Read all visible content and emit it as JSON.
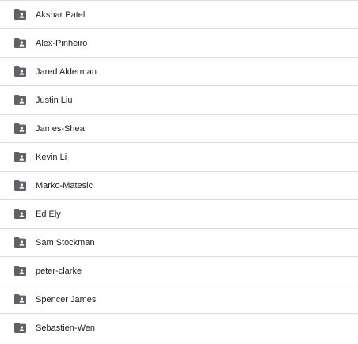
{
  "colors": {
    "folder_icon": "#5f6368",
    "divider": "#dadce0",
    "text": "#202124"
  },
  "folders": [
    {
      "label": "Akshar Patel",
      "icon": "shared-folder-icon"
    },
    {
      "label": "Alex-Pinheiro",
      "icon": "shared-folder-icon"
    },
    {
      "label": "Jared Alderman",
      "icon": "shared-folder-icon"
    },
    {
      "label": "Justin Liu",
      "icon": "shared-folder-icon"
    },
    {
      "label": "James-Shea",
      "icon": "shared-folder-icon"
    },
    {
      "label": "Kevin Li",
      "icon": "shared-folder-icon"
    },
    {
      "label": "Marko-Matesic",
      "icon": "shared-folder-icon"
    },
    {
      "label": "Ed Ely",
      "icon": "shared-folder-icon"
    },
    {
      "label": "Sam Stockman",
      "icon": "shared-folder-icon"
    },
    {
      "label": "peter-clarke",
      "icon": "shared-folder-icon"
    },
    {
      "label": "Spencer James",
      "icon": "shared-folder-icon"
    },
    {
      "label": "Sebastien-Wen",
      "icon": "shared-folder-icon"
    }
  ]
}
